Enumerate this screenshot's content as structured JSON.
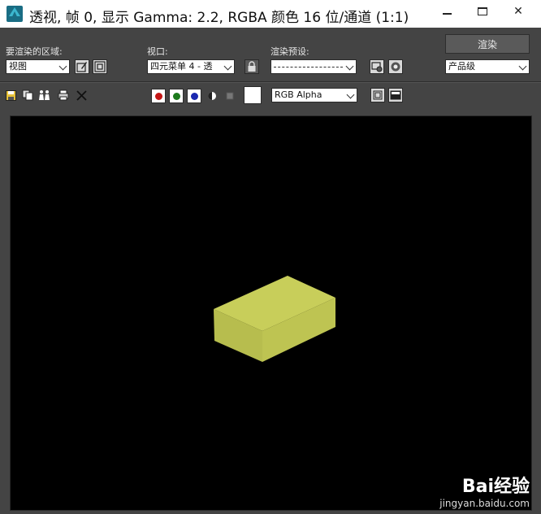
{
  "window": {
    "title": "透视, 帧 0, 显示 Gamma: 2.2, RGBA 颜色 16 位/通道 (1:1)",
    "minimize": "—",
    "close": "✕"
  },
  "toolbar_top": {
    "area_label": "要渲染的区域:",
    "area_value": "视图",
    "viewport_label": "视口:",
    "viewport_value": "四元菜单 4 - 透",
    "preset_label": "渲染预设:",
    "preset_value": "--------------------",
    "render_label": "渲染",
    "quality_value": "产品级"
  },
  "toolbar_bottom": {
    "channel_value": "RGB Alpha",
    "red": "#c41616",
    "green": "#1c7a1c",
    "blue": "#1a28b0"
  },
  "viewport": {
    "background": "#000000",
    "object": "box",
    "object_color": "#c8ce5a"
  },
  "watermark": {
    "brand": "Bai经验",
    "url": "jingyan.baidu.com"
  }
}
